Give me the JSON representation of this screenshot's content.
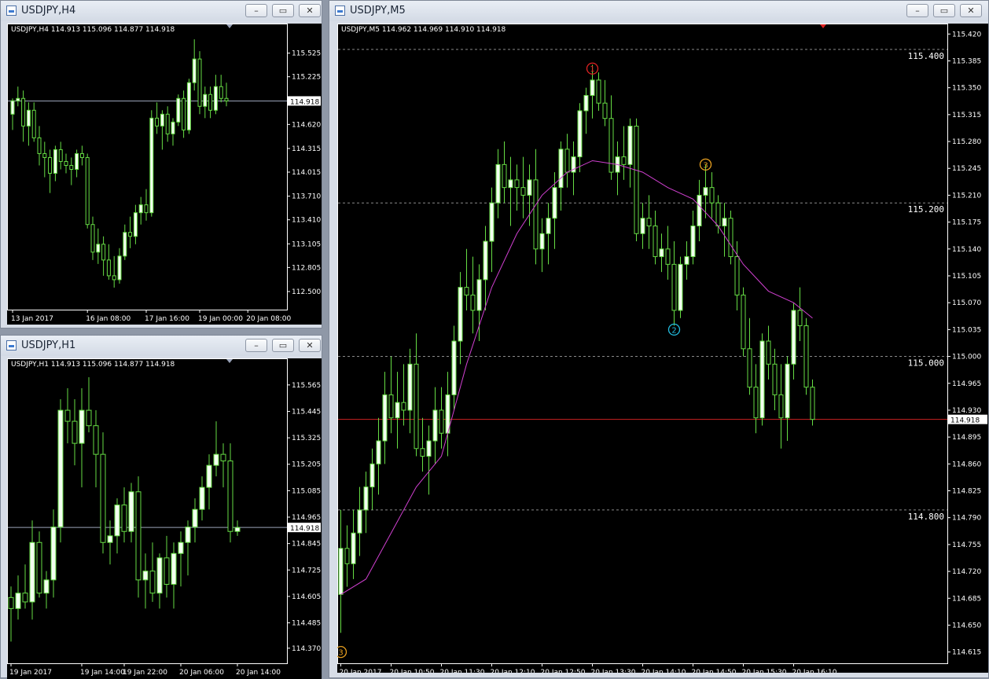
{
  "colors": {
    "background": "#000000",
    "bull_body": "#f2fff0",
    "bear_body": "#000000",
    "wick": "#66dd44",
    "axis_text": "#ffffff",
    "bid_line_m5": "#cc2222",
    "bid_line_small": "#9aa3b8",
    "ma_line": "#d040d0",
    "grid": "#8a8a8a"
  },
  "windows": {
    "h4": {
      "title": "USDJPY,H4",
      "info": "USDJPY,H4  114.913 115.096 114.877 114.918",
      "buttons": {
        "minimize": "–",
        "restore": "▭",
        "close": "✕"
      }
    },
    "h1": {
      "title": "USDJPY,H1",
      "info": "USDJPY,H1  114.913 115.096 114.877 114.918",
      "buttons": {
        "minimize": "–",
        "restore": "▭",
        "close": "✕"
      }
    },
    "m5": {
      "title": "USDJPY,M5",
      "info": "USDJPY,M5  114.962 114.969 114.910 114.918",
      "buttons": {
        "minimize": "–",
        "restore": "▭",
        "close": "✕"
      }
    }
  },
  "chart_data": [
    {
      "id": "h4",
      "type": "candlestick",
      "symbol": "USDJPY",
      "timeframe": "H4",
      "ylim": [
        112.35,
        115.8
      ],
      "y_ticks": [
        "115.525",
        "115.225",
        "114.920",
        "114.620",
        "114.315",
        "114.015",
        "113.710",
        "113.410",
        "113.105",
        "112.805",
        "112.500"
      ],
      "x_ticks": [
        "13 Jan 2017",
        "16 Jan 08:00",
        "17 Jan 16:00",
        "19 Jan 00:00",
        "20 Jan 08:00"
      ],
      "x_tick_index": [
        0,
        14,
        25,
        35,
        44
      ],
      "current_price": "114.918",
      "candles": [
        [
          114.75,
          114.95,
          114.55,
          114.92
        ],
        [
          114.92,
          115.1,
          114.85,
          114.95
        ],
        [
          114.95,
          115.05,
          114.4,
          114.6
        ],
        [
          114.6,
          114.9,
          114.35,
          114.8
        ],
        [
          114.8,
          114.9,
          114.4,
          114.45
        ],
        [
          114.45,
          114.6,
          114.1,
          114.25
        ],
        [
          114.25,
          114.4,
          113.95,
          114.2
        ],
        [
          114.2,
          114.3,
          113.75,
          114.0
        ],
        [
          114.0,
          114.35,
          113.9,
          114.3
        ],
        [
          114.3,
          114.4,
          114.05,
          114.15
        ],
        [
          114.15,
          114.25,
          114.0,
          114.1
        ],
        [
          114.1,
          114.2,
          113.85,
          114.05
        ],
        [
          114.05,
          114.3,
          113.95,
          114.25
        ],
        [
          114.25,
          114.35,
          114.1,
          114.2
        ],
        [
          114.2,
          114.25,
          113.3,
          113.35
        ],
        [
          113.35,
          113.45,
          112.9,
          113.0
        ],
        [
          113.0,
          113.3,
          112.85,
          113.1
        ],
        [
          113.1,
          113.2,
          112.7,
          112.9
        ],
        [
          112.9,
          113.1,
          112.65,
          112.7
        ],
        [
          112.7,
          112.95,
          112.55,
          112.65
        ],
        [
          112.65,
          113.05,
          112.6,
          112.95
        ],
        [
          112.95,
          113.35,
          112.9,
          113.25
        ],
        [
          113.25,
          113.45,
          113.05,
          113.2
        ],
        [
          113.2,
          113.6,
          113.1,
          113.5
        ],
        [
          113.5,
          113.7,
          113.35,
          113.6
        ],
        [
          113.6,
          113.8,
          113.4,
          113.5
        ],
        [
          113.5,
          114.8,
          113.45,
          114.7
        ],
        [
          114.7,
          114.9,
          114.5,
          114.6
        ],
        [
          114.6,
          114.8,
          114.3,
          114.75
        ],
        [
          114.75,
          114.85,
          114.4,
          114.5
        ],
        [
          114.5,
          114.7,
          114.35,
          114.65
        ],
        [
          114.65,
          115.0,
          114.6,
          114.95
        ],
        [
          114.95,
          115.05,
          114.45,
          114.55
        ],
        [
          114.55,
          115.2,
          114.5,
          115.15
        ],
        [
          115.15,
          115.7,
          115.05,
          115.45
        ],
        [
          115.45,
          115.55,
          114.75,
          114.85
        ],
        [
          114.85,
          115.1,
          114.7,
          115.0
        ],
        [
          115.0,
          115.1,
          114.7,
          114.8
        ],
        [
          114.8,
          115.25,
          114.75,
          115.1
        ],
        [
          115.1,
          115.25,
          114.9,
          114.95
        ],
        [
          114.95,
          115.15,
          114.85,
          114.918
        ]
      ]
    },
    {
      "id": "h1",
      "type": "candlestick",
      "symbol": "USDJPY",
      "timeframe": "H1",
      "ylim": [
        114.33,
        115.65
      ],
      "y_ticks": [
        "115.565",
        "115.445",
        "115.325",
        "115.205",
        "115.085",
        "114.965",
        "114.845",
        "114.725",
        "114.605",
        "114.485",
        "114.370"
      ],
      "x_ticks": [
        "19 Jan 2017",
        "19 Jan 14:00",
        "19 Jan 22:00",
        "20 Jan 06:00",
        "20 Jan 14:00"
      ],
      "x_tick_index": [
        0,
        10,
        16,
        24,
        32
      ],
      "current_price": "114.918",
      "candles": [
        [
          114.6,
          114.65,
          114.4,
          114.55
        ],
        [
          114.55,
          114.7,
          114.5,
          114.62
        ],
        [
          114.62,
          114.75,
          114.55,
          114.58
        ],
        [
          114.58,
          114.95,
          114.5,
          114.85
        ],
        [
          114.85,
          114.9,
          114.6,
          114.62
        ],
        [
          114.62,
          114.72,
          114.55,
          114.68
        ],
        [
          114.68,
          115.0,
          114.6,
          114.92
        ],
        [
          114.92,
          115.5,
          114.85,
          115.45
        ],
        [
          115.45,
          115.55,
          115.3,
          115.4
        ],
        [
          115.4,
          115.5,
          115.2,
          115.3
        ],
        [
          115.3,
          115.55,
          115.1,
          115.45
        ],
        [
          115.45,
          115.6,
          115.35,
          115.38
        ],
        [
          115.38,
          115.45,
          115.1,
          115.25
        ],
        [
          115.25,
          115.35,
          114.8,
          114.85
        ],
        [
          114.85,
          114.95,
          114.75,
          114.88
        ],
        [
          114.88,
          115.05,
          114.8,
          115.02
        ],
        [
          115.02,
          115.1,
          114.85,
          114.9
        ],
        [
          114.9,
          115.12,
          114.85,
          115.08
        ],
        [
          115.08,
          115.15,
          114.6,
          114.68
        ],
        [
          114.68,
          114.8,
          114.55,
          114.72
        ],
        [
          114.72,
          114.85,
          114.58,
          114.62
        ],
        [
          114.62,
          114.8,
          114.55,
          114.78
        ],
        [
          114.78,
          114.88,
          114.6,
          114.66
        ],
        [
          114.66,
          114.85,
          114.55,
          114.8
        ],
        [
          114.8,
          114.9,
          114.65,
          114.85
        ],
        [
          114.85,
          114.95,
          114.7,
          114.92
        ],
        [
          114.92,
          115.05,
          114.85,
          115.0
        ],
        [
          115.0,
          115.15,
          114.95,
          115.1
        ],
        [
          115.1,
          115.25,
          115.0,
          115.2
        ],
        [
          115.2,
          115.4,
          115.15,
          115.25
        ],
        [
          115.25,
          115.3,
          115.1,
          115.22
        ],
        [
          115.22,
          115.3,
          114.85,
          114.9
        ],
        [
          114.9,
          114.95,
          114.88,
          114.918
        ]
      ]
    },
    {
      "id": "m5",
      "type": "candlestick",
      "symbol": "USDJPY",
      "timeframe": "M5",
      "ylim": [
        114.6085,
        115.4295
      ],
      "y_ticks": [
        "115.420",
        "115.385",
        "115.350",
        "115.315",
        "115.280",
        "115.245",
        "115.210",
        "115.175",
        "115.140",
        "115.105",
        "115.070",
        "115.035",
        "115.000",
        "114.965",
        "114.930",
        "114.895",
        "114.860",
        "114.825",
        "114.790",
        "114.755",
        "114.720",
        "114.685",
        "114.650",
        "114.615"
      ],
      "x_ticks": [
        "20 Jan 2017",
        "20 Jan 10:50",
        "20 Jan 11:30",
        "20 Jan 12:10",
        "20 Jan 12:50",
        "20 Jan 13:30",
        "20 Jan 14:10",
        "20 Jan 14:50",
        "20 Jan 15:30",
        "20 Jan 16:10"
      ],
      "x_tick_index": [
        0,
        8,
        16,
        24,
        32,
        40,
        48,
        56,
        64,
        72
      ],
      "current_price": "114.918",
      "level_labels": [
        "115.400",
        "115.200",
        "115.000",
        "114.800"
      ],
      "level_values": [
        115.4,
        115.2,
        115.0,
        114.8
      ],
      "markers": [
        {
          "label": "1",
          "index": 40,
          "price": 115.375,
          "color": "#dd2222"
        },
        {
          "label": "2",
          "index": 53,
          "price": 115.035,
          "color": "#22bbdd"
        },
        {
          "label": "3",
          "index": 58,
          "price": 115.25,
          "color": "#e8a020"
        },
        {
          "label": "3",
          "index": 0,
          "price": 114.615,
          "color": "#e8a020"
        }
      ],
      "candles": [
        [
          114.69,
          114.8,
          114.64,
          114.75
        ],
        [
          114.75,
          114.78,
          114.7,
          114.73
        ],
        [
          114.73,
          114.8,
          114.71,
          114.77
        ],
        [
          114.77,
          114.83,
          114.74,
          114.8
        ],
        [
          114.8,
          114.85,
          114.77,
          114.83
        ],
        [
          114.83,
          114.88,
          114.8,
          114.86
        ],
        [
          114.86,
          114.92,
          114.82,
          114.89
        ],
        [
          114.89,
          114.98,
          114.86,
          114.95
        ],
        [
          114.95,
          115.0,
          114.9,
          114.92
        ],
        [
          114.92,
          114.98,
          114.88,
          114.94
        ],
        [
          114.94,
          114.99,
          114.91,
          114.93
        ],
        [
          114.93,
          115.01,
          114.9,
          114.99
        ],
        [
          114.99,
          115.03,
          114.87,
          114.88
        ],
        [
          114.88,
          114.92,
          114.85,
          114.87
        ],
        [
          114.87,
          114.91,
          114.82,
          114.89
        ],
        [
          114.89,
          114.96,
          114.86,
          114.93
        ],
        [
          114.93,
          114.96,
          114.88,
          114.9
        ],
        [
          114.9,
          114.98,
          114.87,
          114.95
        ],
        [
          114.95,
          115.04,
          114.93,
          115.02
        ],
        [
          115.02,
          115.11,
          114.99,
          115.09
        ],
        [
          115.09,
          115.14,
          115.06,
          115.08
        ],
        [
          115.08,
          115.13,
          115.03,
          115.06
        ],
        [
          115.06,
          115.12,
          115.02,
          115.1
        ],
        [
          115.1,
          115.17,
          115.06,
          115.15
        ],
        [
          115.15,
          115.22,
          115.11,
          115.2
        ],
        [
          115.2,
          115.27,
          115.18,
          115.25
        ],
        [
          115.25,
          115.28,
          115.2,
          115.22
        ],
        [
          115.22,
          115.26,
          115.17,
          115.23
        ],
        [
          115.23,
          115.25,
          115.19,
          115.22
        ],
        [
          115.22,
          115.26,
          115.18,
          115.21
        ],
        [
          115.21,
          115.25,
          115.17,
          115.23
        ],
        [
          115.23,
          115.27,
          115.12,
          115.14
        ],
        [
          115.14,
          115.18,
          115.11,
          115.16
        ],
        [
          115.16,
          115.2,
          115.12,
          115.18
        ],
        [
          115.18,
          115.24,
          115.14,
          115.22
        ],
        [
          115.22,
          115.28,
          115.19,
          115.27
        ],
        [
          115.27,
          115.29,
          115.22,
          115.24
        ],
        [
          115.24,
          115.28,
          115.21,
          115.26
        ],
        [
          115.26,
          115.33,
          115.24,
          115.32
        ],
        [
          115.32,
          115.35,
          115.29,
          115.34
        ],
        [
          115.34,
          115.38,
          115.31,
          115.36
        ],
        [
          115.36,
          115.37,
          115.32,
          115.33
        ],
        [
          115.33,
          115.36,
          115.3,
          115.31
        ],
        [
          115.31,
          115.34,
          115.23,
          115.24
        ],
        [
          115.24,
          115.28,
          115.21,
          115.26
        ],
        [
          115.26,
          115.3,
          115.23,
          115.25
        ],
        [
          115.25,
          115.31,
          115.22,
          115.3
        ],
        [
          115.3,
          115.31,
          115.15,
          115.16
        ],
        [
          115.16,
          115.2,
          115.14,
          115.18
        ],
        [
          115.18,
          115.21,
          115.14,
          115.17
        ],
        [
          115.17,
          115.19,
          115.12,
          115.13
        ],
        [
          115.13,
          115.16,
          115.11,
          115.14
        ],
        [
          115.14,
          115.17,
          115.1,
          115.12
        ],
        [
          115.12,
          115.15,
          115.04,
          115.06
        ],
        [
          115.06,
          115.13,
          115.05,
          115.12
        ],
        [
          115.12,
          115.15,
          115.1,
          115.13
        ],
        [
          115.13,
          115.19,
          115.12,
          115.17
        ],
        [
          115.17,
          115.23,
          115.15,
          115.21
        ],
        [
          115.21,
          115.25,
          115.18,
          115.22
        ],
        [
          115.22,
          115.24,
          115.18,
          115.2
        ],
        [
          115.2,
          115.21,
          115.16,
          115.17
        ],
        [
          115.17,
          115.2,
          115.13,
          115.18
        ],
        [
          115.18,
          115.19,
          115.12,
          115.13
        ],
        [
          115.13,
          115.15,
          115.06,
          115.08
        ],
        [
          115.08,
          115.09,
          115.0,
          115.01
        ],
        [
          115.01,
          115.05,
          114.95,
          114.96
        ],
        [
          114.96,
          114.99,
          114.9,
          114.92
        ],
        [
          114.92,
          115.03,
          114.91,
          115.02
        ],
        [
          115.02,
          115.04,
          114.97,
          114.99
        ],
        [
          114.99,
          115.01,
          114.93,
          114.95
        ],
        [
          114.95,
          114.99,
          114.88,
          114.92
        ],
        [
          114.92,
          115.0,
          114.89,
          114.99
        ],
        [
          114.99,
          115.07,
          114.97,
          115.06
        ],
        [
          115.06,
          115.09,
          115.02,
          115.04
        ],
        [
          115.04,
          115.05,
          114.95,
          114.96
        ],
        [
          114.96,
          114.97,
          114.91,
          114.918
        ]
      ],
      "ma": [
        [
          0,
          114.69
        ],
        [
          4,
          114.71
        ],
        [
          8,
          114.77
        ],
        [
          12,
          114.83
        ],
        [
          16,
          114.87
        ],
        [
          20,
          114.99
        ],
        [
          24,
          115.09
        ],
        [
          28,
          115.16
        ],
        [
          32,
          115.21
        ],
        [
          36,
          115.24
        ],
        [
          40,
          115.255
        ],
        [
          44,
          115.25
        ],
        [
          48,
          115.24
        ],
        [
          52,
          115.22
        ],
        [
          56,
          115.205
        ],
        [
          60,
          115.17
        ],
        [
          64,
          115.12
        ],
        [
          68,
          115.085
        ],
        [
          72,
          115.07
        ],
        [
          75,
          115.05
        ]
      ]
    }
  ]
}
